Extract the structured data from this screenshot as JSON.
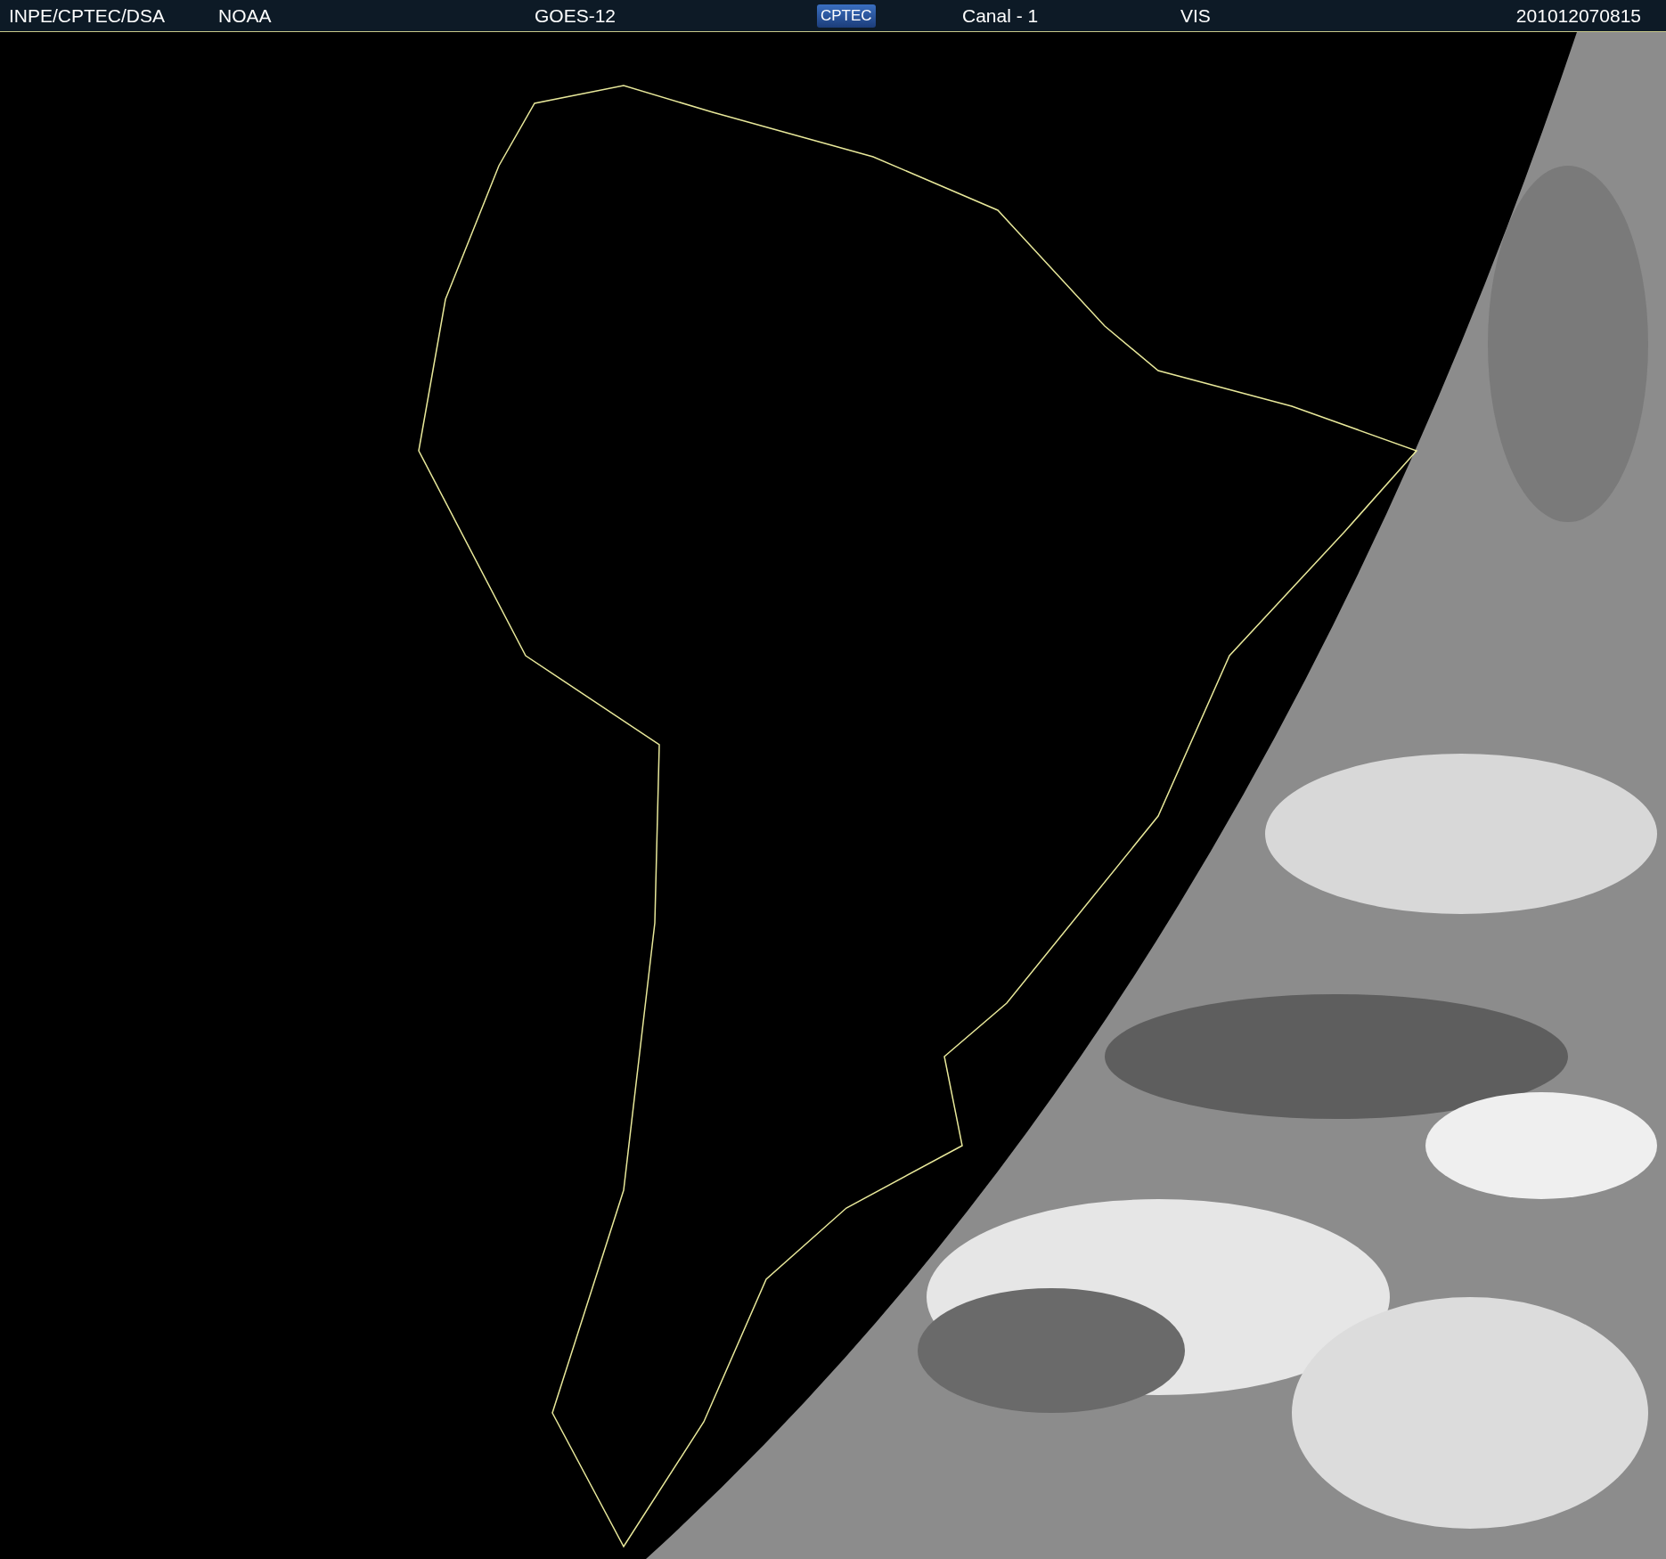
{
  "header": {
    "source": "INPE/CPTEC/DSA",
    "agency": "NOAA",
    "satellite": "GOES-12",
    "logo": "CPTEC",
    "channel": "Canal - 1",
    "band": "VIS",
    "timestamp": "201012070815"
  }
}
